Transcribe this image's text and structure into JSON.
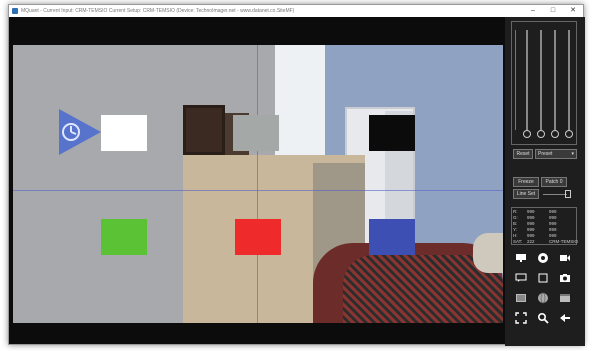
{
  "window": {
    "title": "MQuant - Current Input: CRM-TEMSIO   Current Setup: CRM-TEMSIO   (Device: TechnoImager.net - www.datanet.co.SiteMF)"
  },
  "panel": {
    "reset_label": "Reset",
    "preset_value": "Preset",
    "freeze_label": "Freeze",
    "patch_label": "Patch 0",
    "line_set_label": "Line Set",
    "readout_rows": [
      [
        "R:",
        "999",
        "999"
      ],
      [
        "G:",
        "999",
        "999"
      ],
      [
        "B:",
        "999",
        "999"
      ],
      [
        "Y:",
        "999",
        "999"
      ],
      [
        "H:",
        "999",
        "999"
      ],
      [
        "SAT:",
        "222",
        "CRM-TEMSIO"
      ]
    ],
    "sliders": [
      0.0,
      0.0,
      0.0,
      0.0
    ]
  },
  "overlay": {
    "target_caption": "",
    "swatches": [
      {
        "name": "white",
        "color": "#ffffff"
      },
      {
        "name": "gray",
        "color": "#a4a8a6"
      },
      {
        "name": "black",
        "color": "#0b0b0b"
      },
      {
        "name": "green",
        "color": "#5ac234"
      },
      {
        "name": "red",
        "color": "#ee2a2a"
      },
      {
        "name": "blue",
        "color": "#3e4fb4"
      }
    ]
  },
  "icons": [
    "display-icon",
    "camera-aperture-icon",
    "video-camera-icon",
    "chat-bubble-icon",
    "square-outline-icon",
    "camera-icon",
    "keyboard-icon",
    "globe-icon",
    "calendar-icon",
    "fullscreen-icon",
    "search-icon",
    "back-arrow-icon"
  ]
}
